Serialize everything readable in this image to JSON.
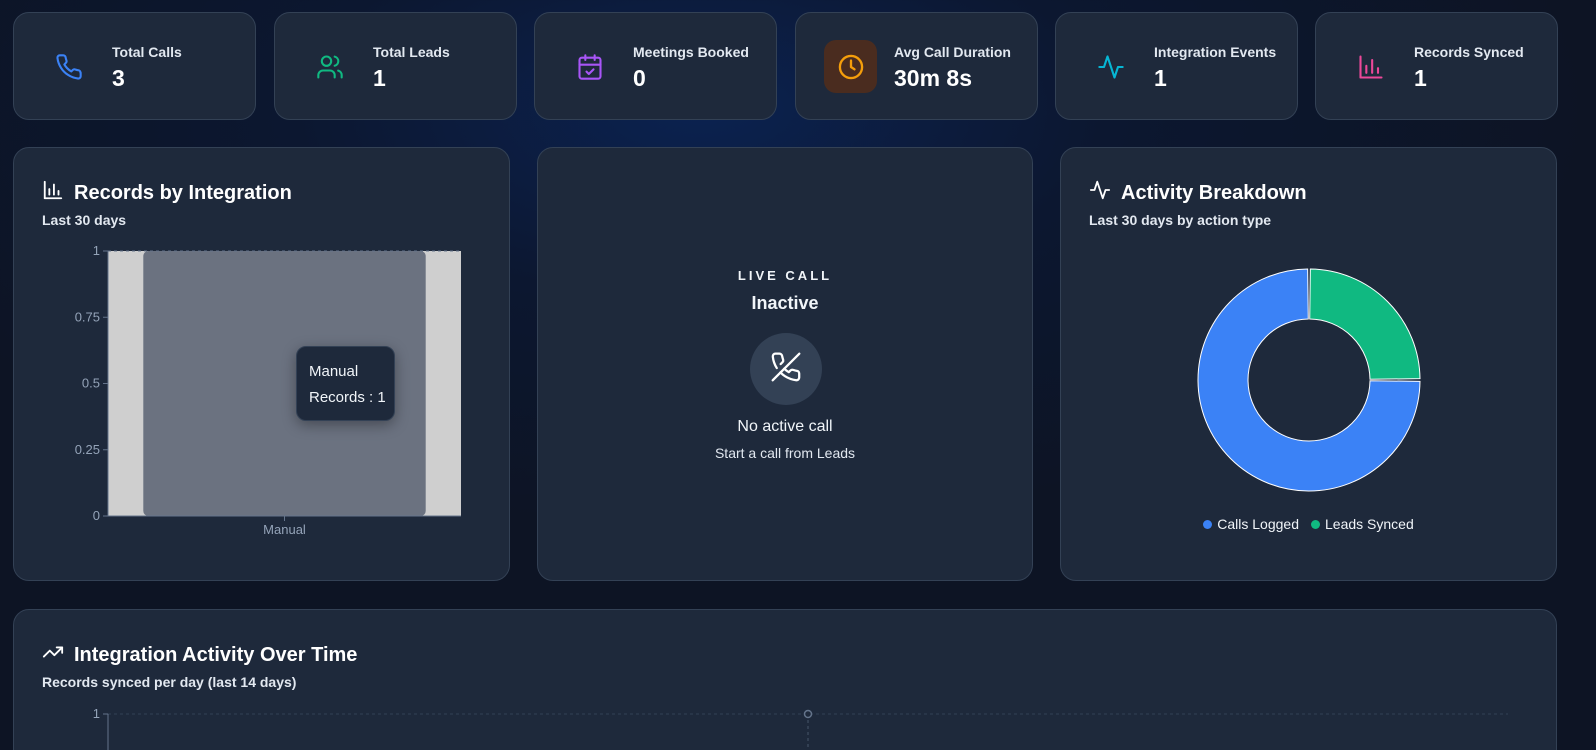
{
  "stats": [
    {
      "label": "Total Calls",
      "value": "3",
      "icon": "phone-icon",
      "color": "#3b82f6"
    },
    {
      "label": "Total Leads",
      "value": "1",
      "icon": "users-icon",
      "color": "#10b981"
    },
    {
      "label": "Meetings Booked",
      "value": "0",
      "icon": "calendar-check-icon",
      "color": "#a855f7"
    },
    {
      "label": "Avg Call Duration",
      "value": "30m 8s",
      "icon": "clock-icon",
      "color": "#f59e0b"
    },
    {
      "label": "Integration Events",
      "value": "1",
      "icon": "activity-icon",
      "color": "#06b6d4"
    },
    {
      "label": "Records Synced",
      "value": "1",
      "icon": "bar-chart-icon",
      "color": "#ec4899"
    }
  ],
  "records_panel": {
    "title": "Records by Integration",
    "subtitle": "Last 30 days",
    "tooltip": {
      "label": "Manual",
      "line": "Records : 1"
    }
  },
  "live_call": {
    "eyebrow": "LIVE CALL",
    "state": "Inactive",
    "message": "No active call",
    "hint": "Start a call from Leads"
  },
  "activity_panel": {
    "title": "Activity Breakdown",
    "subtitle": "Last 30 days by action type"
  },
  "activity_over_time": {
    "title": "Integration Activity Over Time",
    "subtitle": "Records synced per day (last 14 days)"
  },
  "chart_data": [
    {
      "type": "bar",
      "categories": [
        "Manual"
      ],
      "series": [
        {
          "name": "Records",
          "values": [
            1
          ]
        }
      ],
      "ylim": [
        0,
        1
      ],
      "yticks": [
        "0",
        "0.25",
        "0.5",
        "0.75",
        "1"
      ],
      "grid": true,
      "colors": {
        "bar": "#cfcfcf",
        "cursor": "#6b7280"
      }
    },
    {
      "type": "pie",
      "categories": [
        "Calls Logged",
        "Leads Synced"
      ],
      "values": [
        3,
        1
      ],
      "colors": [
        "#3b82f6",
        "#10b981"
      ],
      "legend": "bottom"
    },
    {
      "type": "line",
      "ylim": [
        0,
        1
      ],
      "yticks": [
        "1"
      ],
      "grid": true
    }
  ]
}
